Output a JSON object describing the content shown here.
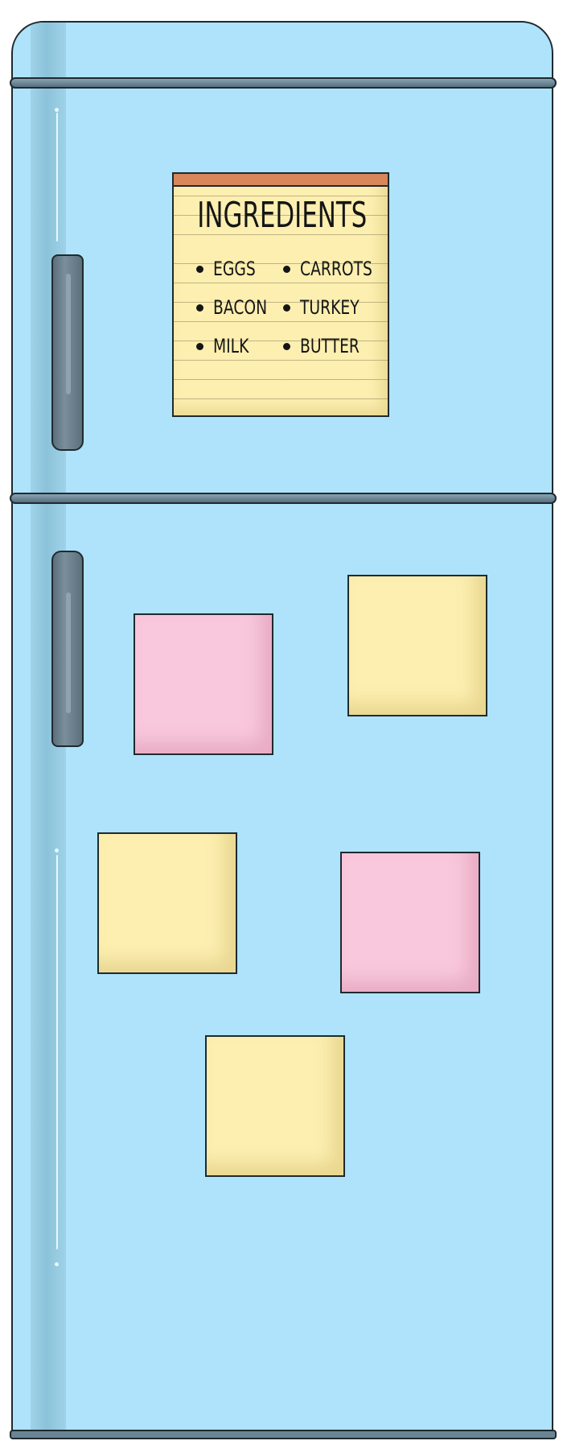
{
  "fridge": {
    "colors": {
      "body": "#aee3fb",
      "trim": "#6a8494",
      "outline": "#1e2a30"
    }
  },
  "ingredients_note": {
    "title": "INGREDIENTS",
    "items": [
      "EGGS",
      "CARROTS",
      "BACON",
      "TURKEY",
      "MILK",
      "BUTTER"
    ],
    "colors": {
      "paper": "#fcefb0",
      "header": "#d8865a"
    }
  },
  "sticky_notes": [
    {
      "color": "#f9c8dc"
    },
    {
      "color": "#fcefb0"
    },
    {
      "color": "#fcefb0"
    },
    {
      "color": "#f9c8dc"
    },
    {
      "color": "#fcefb0"
    }
  ]
}
